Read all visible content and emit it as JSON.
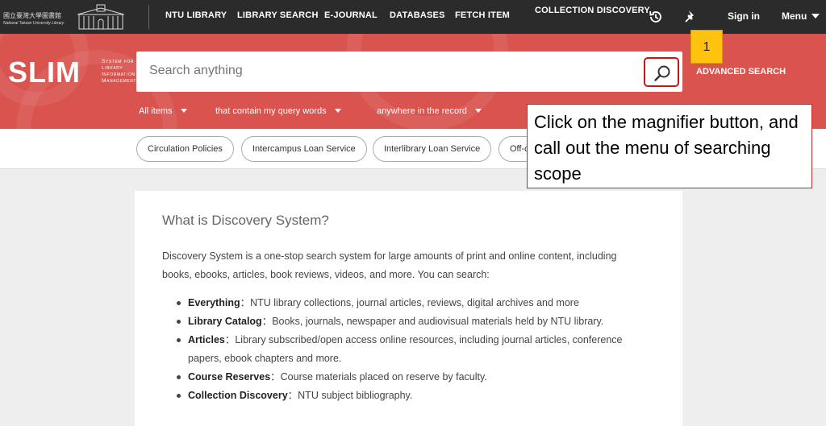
{
  "topnav": {
    "logo_cn": "國立臺灣大學圖書館",
    "logo_en": "National Taiwan University Library",
    "links": [
      "NTU LIBRARY",
      "LIBRARY SEARCH",
      "E-JOURNAL",
      "DATABASES",
      "FETCH ITEM"
    ],
    "collection_discovery": "COLLECTION DISCOVERY",
    "history_icon": "history-icon",
    "pin_icon": "pin-icon",
    "sign_in": "Sign in",
    "menu": "Menu"
  },
  "search": {
    "logo_word": "SLIM",
    "logo_sub_1": "System for",
    "logo_sub_2": "Library",
    "logo_sub_3": "Information",
    "logo_sub_4": "Management",
    "placeholder": "Search anything",
    "button_icon": "magnifier-icon",
    "advanced": "ADVANCED SEARCH",
    "scope_items": "All items",
    "scope_contain": "that contain my query words",
    "scope_where": "anywhere in the record"
  },
  "quick_links": [
    "Circulation Policies",
    "Intercampus Loan Service",
    "Interlibrary Loan Service",
    "Off-c"
  ],
  "card": {
    "title": "What is Discovery System?",
    "intro": "Discovery System is a one-stop search system for large amounts of print and online content, including books, ebooks, articles, book reviews, videos, and more. You can search:",
    "items": [
      {
        "term": "Everything",
        "desc": "：NTU library collections, journal articles, reviews, digital archives and more"
      },
      {
        "term": "Library Catalog",
        "desc": "：Books, journals, newspaper and audiovisual materials held by NTU library."
      },
      {
        "term": "Articles",
        "desc": "：Library subscribed/open access online resources, including journal articles, conference papers, ebook chapters and more."
      },
      {
        "term": "Course Reserves",
        "desc": "：Course materials placed on reserve by faculty."
      },
      {
        "term": "Collection Discovery",
        "desc": "：NTU subject bibliography."
      }
    ]
  },
  "annotation": {
    "badge": "1",
    "callout": "Click on the magnifier button, and call out the menu of searching scope"
  },
  "colors": {
    "topbar": "#2b2b2b",
    "brand_red": "#d9534f",
    "badge_yellow": "#ffc20e",
    "callout_border": "#c62828"
  }
}
